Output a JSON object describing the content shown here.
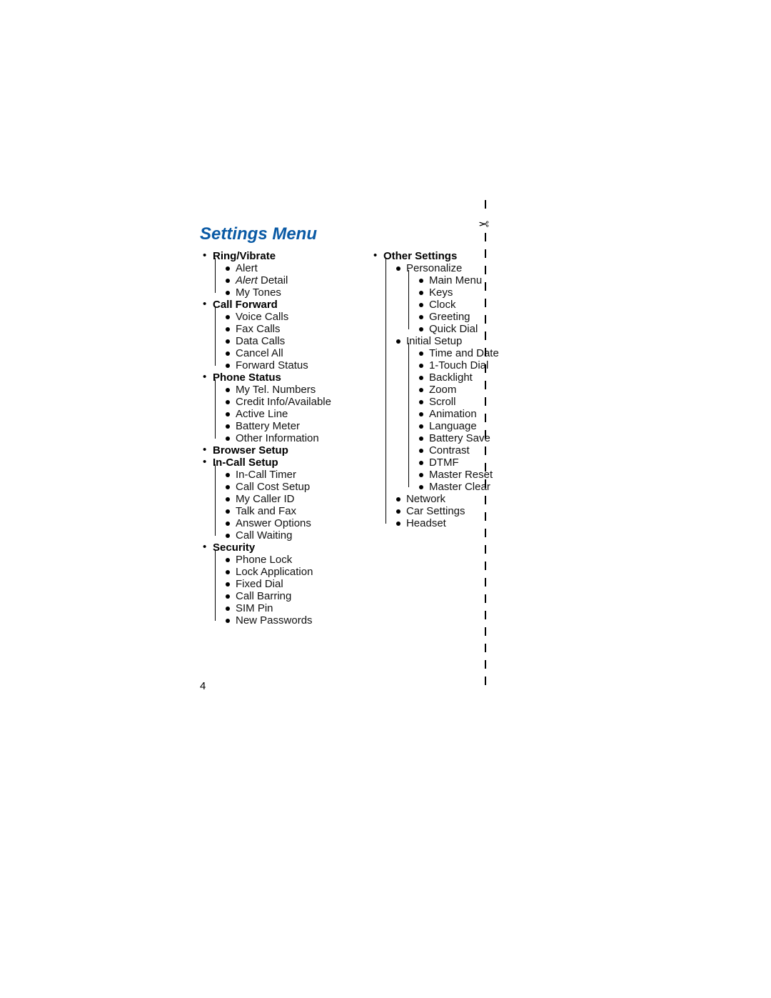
{
  "title": "Settings Menu",
  "page_number": "4",
  "scissors_glyph": "✂",
  "left_column": [
    {
      "label": "Ring/Vibrate",
      "bold": true,
      "children": [
        {
          "label": "Alert"
        },
        {
          "label_html": "<span class='italic'>Alert</span> Detail"
        },
        {
          "label": "My Tones"
        }
      ]
    },
    {
      "label": "Call Forward",
      "bold": true,
      "children": [
        {
          "label": "Voice Calls"
        },
        {
          "label": "Fax Calls"
        },
        {
          "label": "Data Calls"
        },
        {
          "label": "Cancel All"
        },
        {
          "label": "Forward Status"
        }
      ]
    },
    {
      "label": "Phone Status",
      "bold": true,
      "children": [
        {
          "label": "My Tel. Numbers"
        },
        {
          "label": "Credit Info/Available"
        },
        {
          "label": "Active Line"
        },
        {
          "label": "Battery Meter"
        },
        {
          "label": "Other Information"
        }
      ]
    },
    {
      "label": "Browser Setup",
      "bold": true
    },
    {
      "label": "In-Call Setup",
      "bold": true,
      "children": [
        {
          "label": "In-Call Timer"
        },
        {
          "label": "Call Cost Setup"
        },
        {
          "label": "My Caller ID"
        },
        {
          "label": "Talk and Fax"
        },
        {
          "label": "Answer Options"
        },
        {
          "label": "Call Waiting"
        }
      ]
    },
    {
      "label": "Security",
      "bold": true,
      "children": [
        {
          "label": "Phone Lock"
        },
        {
          "label": "Lock Application"
        },
        {
          "label": "Fixed Dial"
        },
        {
          "label": "Call Barring"
        },
        {
          "label": "SIM Pin"
        },
        {
          "label": "New Passwords"
        }
      ]
    }
  ],
  "right_column": [
    {
      "label": "Other Settings",
      "bold": true,
      "children": [
        {
          "label": "Personalize",
          "children": [
            {
              "label": "Main Menu"
            },
            {
              "label": "Keys"
            },
            {
              "label": "Clock"
            },
            {
              "label": "Greeting"
            },
            {
              "label": "Quick Dial"
            }
          ]
        },
        {
          "label": "Initial Setup",
          "children": [
            {
              "label": "Time and Date"
            },
            {
              "label": "1-Touch Dial"
            },
            {
              "label": "Backlight"
            },
            {
              "label": "Zoom"
            },
            {
              "label": "Scroll"
            },
            {
              "label": "Animation"
            },
            {
              "label": "Language"
            },
            {
              "label": "Battery Save"
            },
            {
              "label": "Contrast"
            },
            {
              "label": "DTMF"
            },
            {
              "label": "Master Reset"
            },
            {
              "label": "Master Clear"
            }
          ]
        },
        {
          "label": "Network"
        },
        {
          "label": "Car Settings"
        },
        {
          "label": "Headset"
        }
      ]
    }
  ]
}
